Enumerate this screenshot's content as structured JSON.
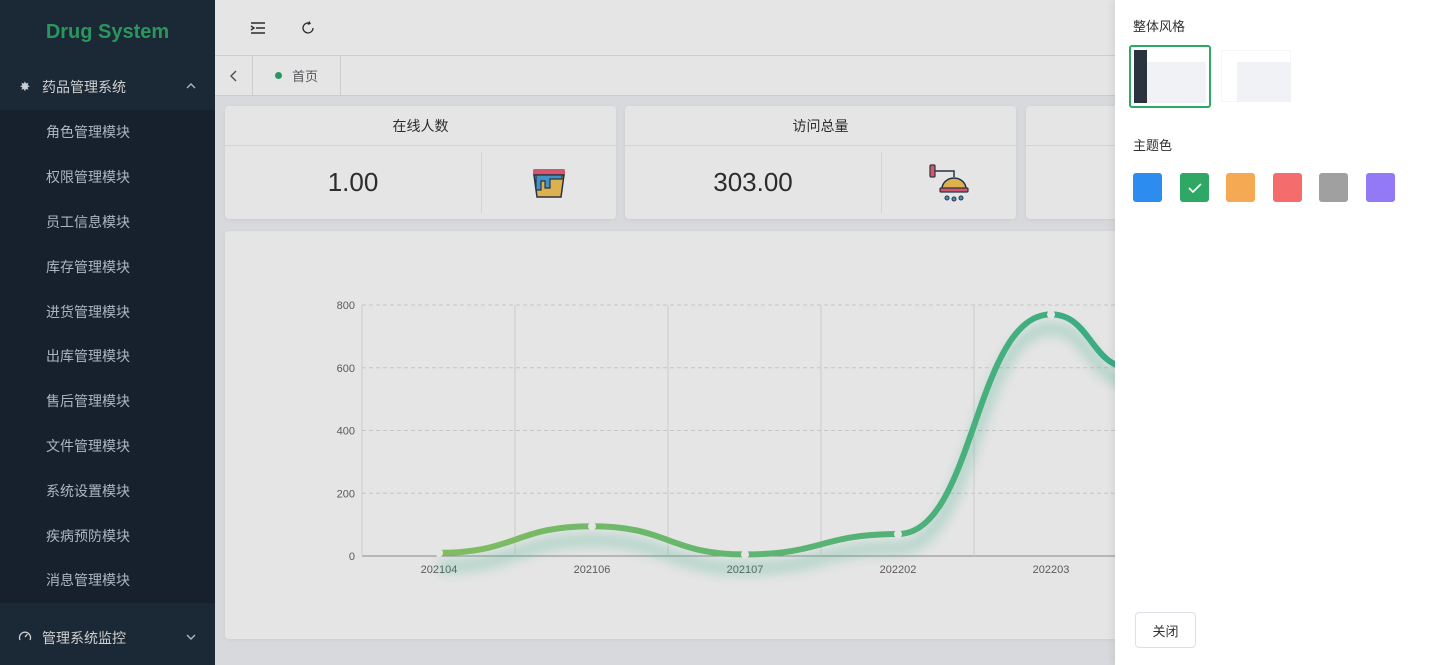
{
  "app": {
    "logo_text": "Drug System",
    "brand_color": "#2fa866"
  },
  "sidebar": {
    "group_title": "药品管理系统",
    "group_icon": "gear-icon",
    "items": [
      {
        "label": "角色管理模块"
      },
      {
        "label": "权限管理模块"
      },
      {
        "label": "员工信息模块"
      },
      {
        "label": "库存管理模块"
      },
      {
        "label": "进货管理模块"
      },
      {
        "label": "出库管理模块"
      },
      {
        "label": "售后管理模块"
      },
      {
        "label": "文件管理模块"
      },
      {
        "label": "系统设置模块"
      },
      {
        "label": "疾病预防模块"
      },
      {
        "label": "消息管理模块"
      }
    ],
    "bottom_group_title": "管理系统监控",
    "bottom_group_icon": "dashboard-icon"
  },
  "navbar": {
    "icons": [
      "menu-fold-icon",
      "refresh-icon"
    ]
  },
  "tags": {
    "back_icon": "chevron-left-icon",
    "active_tag": "首页"
  },
  "cards": [
    {
      "title": "在线人数",
      "value": "1.00",
      "icon": "paint-bucket-icon"
    },
    {
      "title": "访问总量",
      "value": "303.00",
      "icon": "shower-icon"
    },
    {
      "title": "",
      "value": "",
      "icon": ""
    }
  ],
  "chart_data": {
    "type": "line",
    "categories": [
      "202104",
      "202106",
      "202107",
      "202202",
      "202203"
    ],
    "values": [
      10,
      95,
      5,
      70,
      770
    ],
    "yticks": [
      0,
      200,
      400,
      600,
      800
    ],
    "ylim": [
      0,
      800
    ],
    "title": "",
    "xlabel": "",
    "ylabel": "",
    "smooth": true,
    "grid": "dashed",
    "line_color_start": "#91d36b",
    "line_color_end": "#3ebf94"
  },
  "drawer": {
    "style_title": "整体风格",
    "theme_title": "主题色",
    "theme_colors": [
      "#2d8cf0",
      "#2fa866",
      "#f5a952",
      "#f56c6c",
      "#a0a0a0",
      "#9479f7"
    ],
    "selected_theme_index": 1,
    "close_label": "关闭"
  }
}
